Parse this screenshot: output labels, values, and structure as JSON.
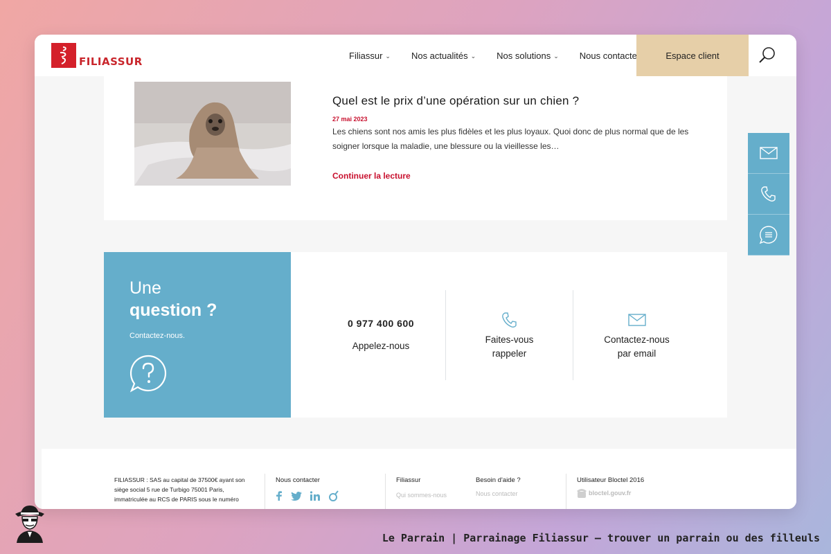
{
  "header": {
    "logo_text": "FILIASSUR",
    "nav": [
      {
        "label": "Filiassur",
        "dropdown": true
      },
      {
        "label": "Nos actualités",
        "dropdown": true
      },
      {
        "label": "Nos solutions",
        "dropdown": true
      },
      {
        "label": "Nous contacter",
        "dropdown": false
      }
    ],
    "espace_client": "Espace client",
    "search_icon": "search-icon"
  },
  "article": {
    "title": "Quel est le prix d’une opération sur un chien ?",
    "date": "27 mai 2023",
    "excerpt": "Les chiens sont nos amis les plus fidèles et les plus loyaux. Quoi donc de plus normal que de les soigner lorsque la maladie, une blessure ou la vieillesse les…",
    "read_more": "Continuer la lecture"
  },
  "question": {
    "line1": "Une",
    "line2": "question ?",
    "sub": "Contactez-nous."
  },
  "contacts": {
    "phone_number": "0 977 400 600",
    "phone_label": "Appelez-nous",
    "callback_line1": "Faites-vous",
    "callback_line2": "rappeler",
    "email_line1": "Contactez-nous",
    "email_line2": "par email"
  },
  "footer": {
    "legal": "FILIASSUR : SAS au capital de 37500€ ayant son siège social 5 rue de Turbigo 75001 Paris, immatriculée au RCS de PARIS sous le numéro",
    "contact_heading": "Nous contacter",
    "col_filiassur_heading": "Filiassur",
    "col_filiassur_link": "Qui sommes-nous",
    "col_aide_heading": "Besoin d'aide ?",
    "col_aide_link": "Nous contacter",
    "bloctel_heading": "Utilisateur Bloctel 2016",
    "bloctel_logo": "bloctel.gouv.fr"
  },
  "caption": "Le Parrain | Parrainage Filiassur — trouver un parrain ou des filleuls",
  "colors": {
    "brand_red": "#d4202a",
    "accent_blue": "#65aecb",
    "espace_bg": "#e6cfa8",
    "link_red": "#c8102e"
  }
}
